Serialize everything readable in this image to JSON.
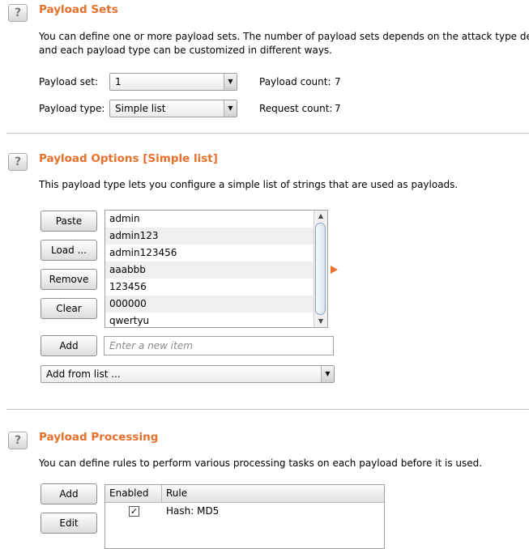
{
  "payload_sets": {
    "help_icon": "?",
    "title": "Payload Sets",
    "description_line1": "You can define one or more payload sets. The number of payload sets depends on the attack type define",
    "description_line2": "and each payload type can be customized in different ways.",
    "payload_set_label": "Payload set:",
    "payload_set_value": "1",
    "payload_type_label": "Payload type:",
    "payload_type_value": "Simple list",
    "payload_count_label": "Payload count:",
    "payload_count_value": "7",
    "request_count_label": "Request count:",
    "request_count_value": "7"
  },
  "payload_options": {
    "help_icon": "?",
    "title": "Payload Options [Simple list]",
    "description": "This payload type lets you configure a simple list of strings that are used as payloads.",
    "buttons": {
      "paste": "Paste",
      "load": "Load ...",
      "remove": "Remove",
      "clear": "Clear",
      "add": "Add"
    },
    "items": [
      "admin",
      "admin123",
      "admin123456",
      "aaabbb",
      "123456",
      "000000",
      "qwertyu"
    ],
    "new_item_placeholder": "Enter a new item",
    "add_from_list": "Add from list ..."
  },
  "payload_processing": {
    "help_icon": "?",
    "title": "Payload Processing",
    "description": "You can define rules to perform various processing tasks on each payload before it is used.",
    "buttons": {
      "add": "Add",
      "edit": "Edit"
    },
    "columns": [
      "Enabled",
      "Rule"
    ],
    "rules": [
      {
        "enabled": true,
        "rule": "Hash: MD5"
      }
    ]
  },
  "colors": {
    "section_title": "#e8702a",
    "expand_arrow": "#e8702a"
  }
}
